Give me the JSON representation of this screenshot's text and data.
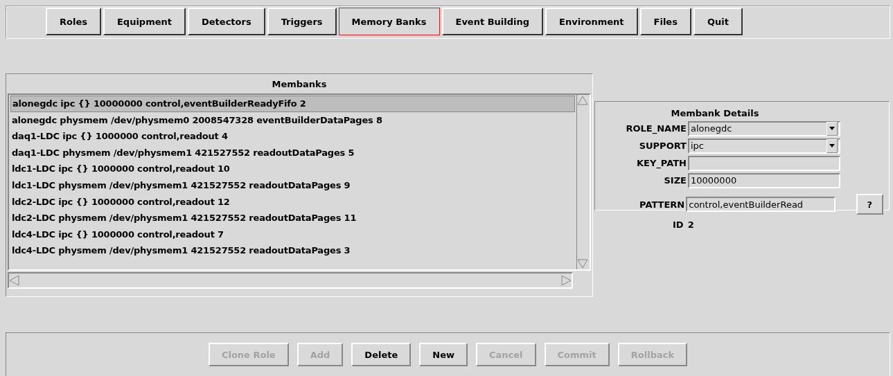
{
  "menu": [
    {
      "label": "Roles",
      "selected": false
    },
    {
      "label": "Equipment",
      "selected": false
    },
    {
      "label": "Detectors",
      "selected": false
    },
    {
      "label": "Triggers",
      "selected": false
    },
    {
      "label": "Memory Banks",
      "selected": true
    },
    {
      "label": "Event Building",
      "selected": false
    },
    {
      "label": "Environment",
      "selected": false
    },
    {
      "label": "Files",
      "selected": false
    },
    {
      "label": "Quit",
      "selected": false
    }
  ],
  "membanks": {
    "title": "Membanks",
    "rows": [
      {
        "text": "alonegdc ipc {} 10000000 control,eventBuilderReadyFifo 2",
        "selected": true
      },
      {
        "text": "alonegdc physmem /dev/physmem0 2008547328 eventBuilderDataPages 8",
        "selected": false
      },
      {
        "text": "daq1-LDC ipc {} 1000000 control,readout 4",
        "selected": false
      },
      {
        "text": "daq1-LDC physmem /dev/physmem1 421527552 readoutDataPages 5",
        "selected": false
      },
      {
        "text": "ldc1-LDC ipc {} 1000000 control,readout 10",
        "selected": false
      },
      {
        "text": "ldc1-LDC physmem /dev/physmem1 421527552 readoutDataPages 9",
        "selected": false
      },
      {
        "text": "ldc2-LDC ipc {} 1000000 control,readout 12",
        "selected": false
      },
      {
        "text": "ldc2-LDC physmem /dev/physmem1 421527552 readoutDataPages 11",
        "selected": false
      },
      {
        "text": "ldc4-LDC ipc {} 1000000 control,readout 7",
        "selected": false
      },
      {
        "text": "ldc4-LDC physmem /dev/physmem1 421527552 readoutDataPages 3",
        "selected": false
      }
    ]
  },
  "details": {
    "title": "Membank Details",
    "fields": [
      {
        "label": "ROLE_NAME",
        "kind": "dropdown",
        "value": "alonegdc"
      },
      {
        "label": "SUPPORT",
        "kind": "dropdown",
        "value": "ipc"
      },
      {
        "label": "KEY_PATH",
        "kind": "text"
      },
      {
        "label": "SIZE",
        "kind": "text",
        "value": "10000000"
      },
      {
        "label": "PATTERN",
        "kind": "text",
        "value": "control,eventBuilderRead",
        "button": "?"
      }
    ],
    "id_label": "ID",
    "id_value": "2"
  },
  "actions": [
    {
      "label": "Clone Role",
      "disabled": true
    },
    {
      "label": "Add",
      "disabled": true
    },
    {
      "label": "Delete",
      "disabled": false
    },
    {
      "label": "New",
      "disabled": false
    },
    {
      "label": "Cancel",
      "disabled": true
    },
    {
      "label": "Commit",
      "disabled": true
    },
    {
      "label": "Rollback",
      "disabled": true
    }
  ]
}
